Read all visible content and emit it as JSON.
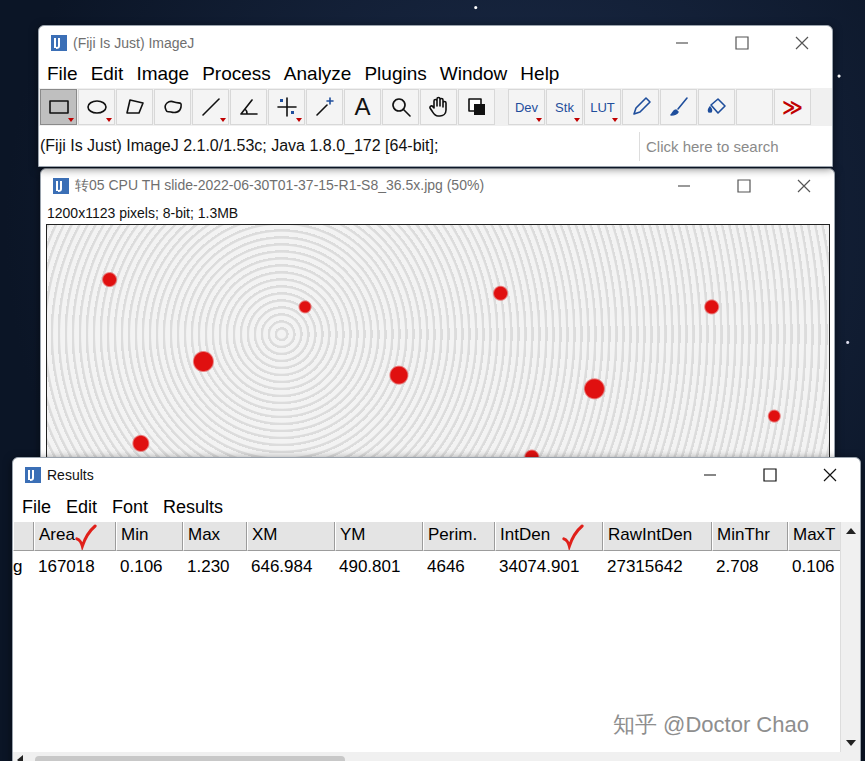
{
  "imagej": {
    "title": "(Fiji Is Just) ImageJ",
    "menu": [
      "File",
      "Edit",
      "Image",
      "Process",
      "Analyze",
      "Plugins",
      "Window",
      "Help"
    ],
    "tools": [
      {
        "kind": "icon",
        "selected": true,
        "dropdown": true
      },
      {
        "kind": "icon",
        "selected": false,
        "dropdown": true
      },
      {
        "kind": "icon",
        "selected": false,
        "dropdown": false
      },
      {
        "kind": "icon",
        "selected": false,
        "dropdown": false
      },
      {
        "kind": "icon",
        "selected": false,
        "dropdown": true
      },
      {
        "kind": "icon",
        "selected": false,
        "dropdown": false
      },
      {
        "kind": "icon",
        "selected": false,
        "dropdown": true
      },
      {
        "kind": "icon",
        "selected": false,
        "dropdown": false
      },
      {
        "kind": "text",
        "label": "A",
        "selected": false,
        "dropdown": false
      },
      {
        "kind": "icon",
        "selected": false,
        "dropdown": false
      },
      {
        "kind": "icon",
        "selected": false,
        "dropdown": false
      },
      {
        "kind": "icon",
        "selected": false,
        "dropdown": false
      },
      {
        "kind": "small",
        "label": "Dev",
        "selected": false,
        "dropdown": true
      },
      {
        "kind": "small",
        "label": "Stk",
        "selected": false,
        "dropdown": true
      },
      {
        "kind": "small",
        "label": "LUT",
        "selected": false,
        "dropdown": true
      },
      {
        "kind": "icon",
        "selected": false,
        "dropdown": false
      },
      {
        "kind": "icon",
        "selected": false,
        "dropdown": false
      },
      {
        "kind": "icon",
        "selected": false,
        "dropdown": false
      },
      {
        "kind": "blank",
        "selected": false,
        "dropdown": false
      },
      {
        "kind": "more",
        "label": "≫",
        "selected": false,
        "dropdown": false
      }
    ],
    "status": "(Fiji Is Just) ImageJ 2.1.0/1.53c; Java 1.8.0_172 [64-bit];",
    "search": {
      "placeholder": "Click here to search"
    }
  },
  "image_window": {
    "title": "转05 CPU TH slide-2022-06-30T01-37-15-R1-S8_36.5x.jpg (50%)",
    "info": "1200x1123 pixels; 8-bit; 1.3MB"
  },
  "results": {
    "title": "Results",
    "menu": [
      "File",
      "Edit",
      "Font",
      "Results"
    ],
    "columns": [
      {
        "label": "Area",
        "marked": true
      },
      {
        "label": "Min",
        "marked": false
      },
      {
        "label": "Max",
        "marked": false
      },
      {
        "label": "XM",
        "marked": false
      },
      {
        "label": "YM",
        "marked": false
      },
      {
        "label": "Perim.",
        "marked": false
      },
      {
        "label": "IntDen",
        "marked": true
      },
      {
        "label": "RawIntDen",
        "marked": false
      },
      {
        "label": "MinThr",
        "marked": false
      },
      {
        "label": "MaxT",
        "marked": false
      }
    ],
    "rows": [
      {
        "label": "g",
        "cells": [
          "167018",
          "0.106",
          "1.230",
          "646.984",
          "490.801",
          "4646",
          "34074.901",
          "27315642",
          "2.708",
          "0.106"
        ]
      }
    ]
  },
  "watermark": "知乎 @Doctor Chao"
}
